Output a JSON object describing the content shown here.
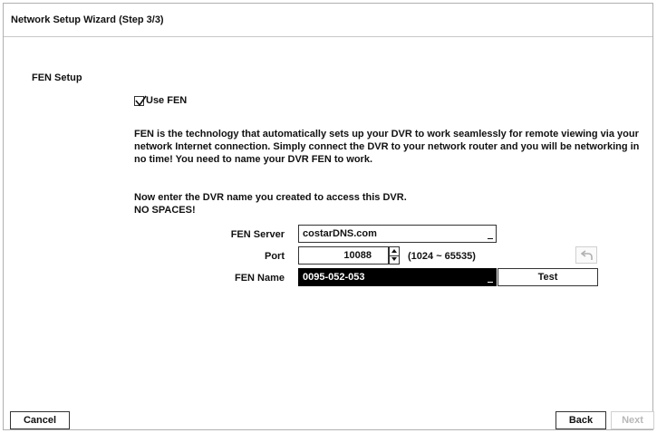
{
  "window": {
    "title": "Network Setup Wizard (Step 3/3)"
  },
  "section": {
    "title": "FEN Setup"
  },
  "use_fen": {
    "label": "Use FEN",
    "checked": true
  },
  "description": {
    "paragraph": "FEN is the technology that automatically sets up your DVR to work seamlessly for remote viewing via your network Internet connection. Simply connect the DVR to your network router and you will be networking in no time! You need to name your DVR FEN to work.",
    "instruction_line1": "Now enter the DVR name you created to access this DVR.",
    "instruction_line2": "NO SPACES!"
  },
  "fields": {
    "server_label": "FEN Server",
    "server_value": "costarDNS.com",
    "port_label": "Port",
    "port_value": "10088",
    "port_range": "(1024 ~ 65535)",
    "name_label": "FEN Name",
    "name_value": "0095-052-053"
  },
  "buttons": {
    "test": "Test",
    "cancel": "Cancel",
    "back": "Back",
    "next": "Next"
  },
  "icons": {
    "reset": "undo-arrow-icon",
    "spin_up": "arrow-up-icon",
    "spin_down": "arrow-down-icon",
    "checkbox": "checkmark-icon"
  },
  "colors": {
    "selected_field_bg": "#000000",
    "disabled_text": "#b8b8b8"
  }
}
